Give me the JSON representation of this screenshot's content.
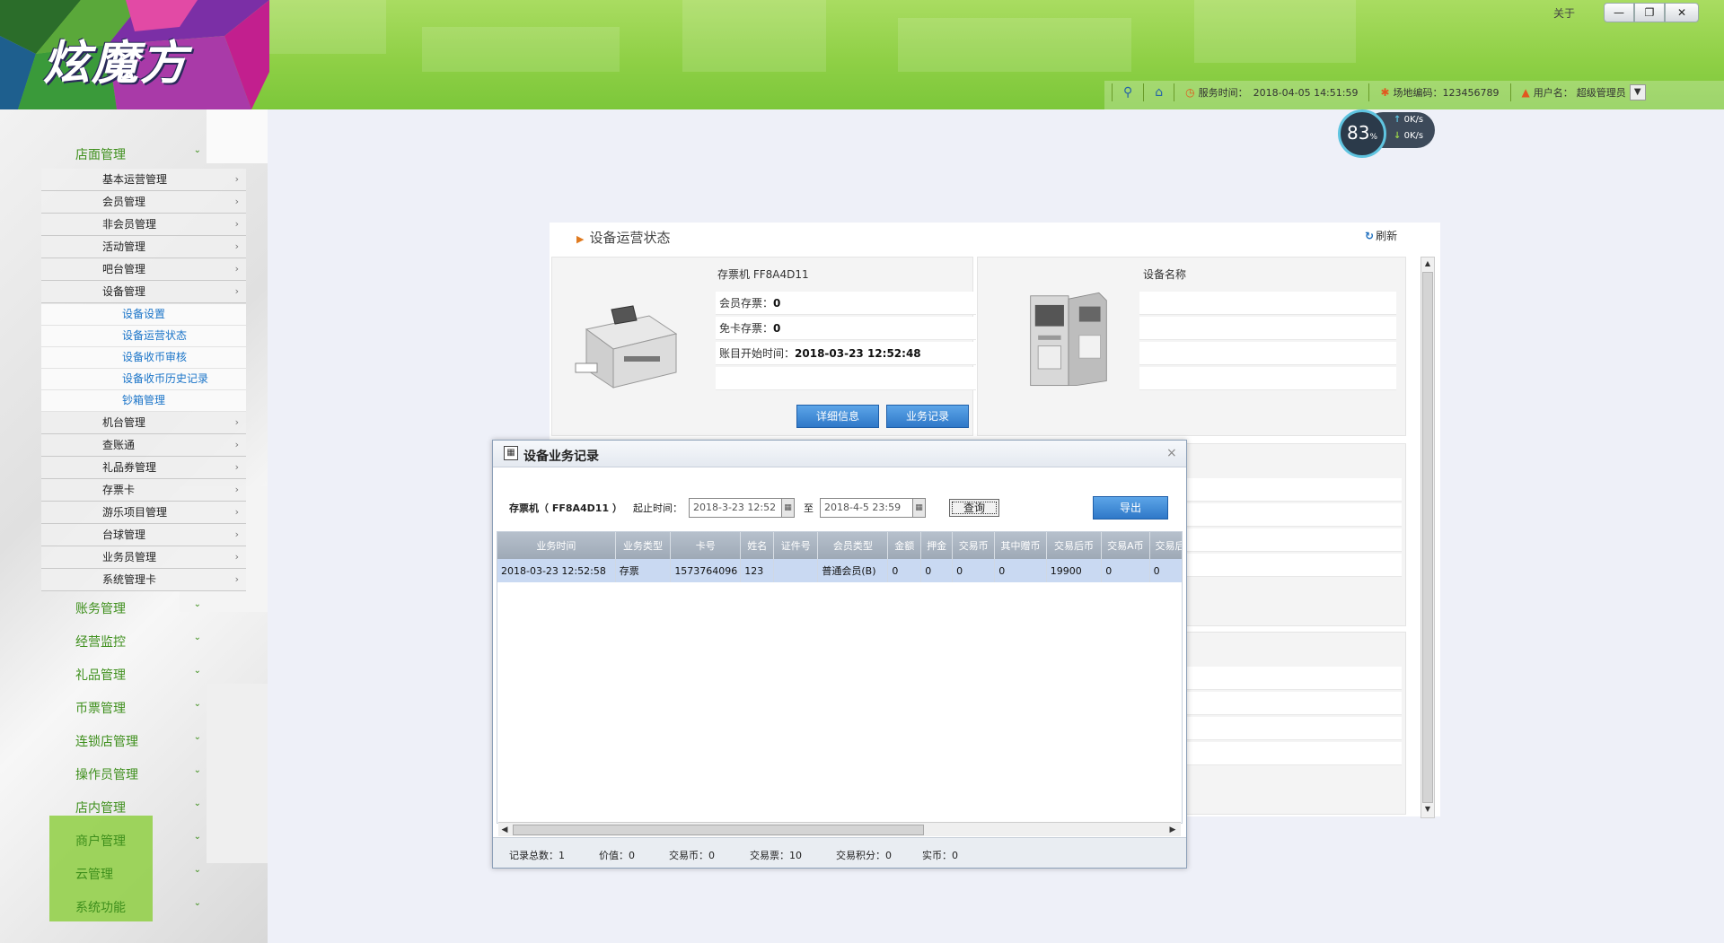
{
  "app": {
    "logo_text": "炫魔方",
    "about": "关于",
    "win_min": "—",
    "win_restore": "❐",
    "win_close": "✕"
  },
  "topbar": {
    "service_time_label": "服务时间：",
    "service_time": "2018-04-05 14:51:59",
    "venue_code_label": "场地编码：",
    "venue_code": "123456789",
    "user_label": "用户名：",
    "user_name": "超级管理员"
  },
  "speed": {
    "percent": "83",
    "unit": "%",
    "up": "0K/s",
    "down": "0K/s"
  },
  "sidebar": {
    "group_store": "店面管理",
    "items": [
      "基本运营管理",
      "会员管理",
      "非会员管理",
      "活动管理",
      "吧台管理",
      "设备管理"
    ],
    "device_sub": [
      "设备设置",
      "设备运营状态",
      "设备收币审核",
      "设备收币历史记录",
      "钞箱管理"
    ],
    "items2": [
      "机台管理",
      "查账通",
      "礼品券管理",
      "存票卡",
      "游乐项目管理",
      "台球管理",
      "业务员管理",
      "系统管理卡"
    ],
    "groups": [
      "账务管理",
      "经营监控",
      "礼品管理",
      "币票管理",
      "连锁店管理",
      "操作员管理",
      "店内管理",
      "商户管理",
      "云管理",
      "系统功能"
    ]
  },
  "panel": {
    "title": "设备运营状态",
    "refresh": "刷新",
    "card1": {
      "name": "存票机 FF8A4D11",
      "member_label": "会员存票：",
      "member_value": "0",
      "free_label": "免卡存票：",
      "free_value": "0",
      "start_label": "账目开始时间：",
      "start_value": "2018-03-23 12:52:48",
      "btn_detail": "详细信息",
      "btn_records": "业务记录"
    },
    "card2": {
      "name": "设备名称"
    }
  },
  "dialog": {
    "title": "设备业务记录",
    "close": "×",
    "device": "存票机（ FF8A4D11 ）",
    "range_label": "起止时间：",
    "start": "2018-3-23 12:52",
    "to": "至",
    "end": "2018-4-5 23:59",
    "query": "查询",
    "export": "导出",
    "columns": [
      "业务时间",
      "业务类型",
      "卡号",
      "姓名",
      "证件号",
      "会员类型",
      "金额",
      "押金",
      "交易币",
      "其中赠币",
      "交易后币",
      "交易A币",
      "交易后A"
    ],
    "rows": [
      [
        "2018-03-23 12:52:58",
        "存票",
        "1573764096",
        "123",
        "",
        "普通会员(B)",
        "0",
        "0",
        "0",
        "0",
        "19900",
        "0",
        "0"
      ]
    ],
    "footer": {
      "total": "记录总数：1",
      "value": "价值：0",
      "coins": "交易币：0",
      "tickets": "交易票：10",
      "points": "交易积分：0",
      "cash": "实币：0"
    }
  }
}
